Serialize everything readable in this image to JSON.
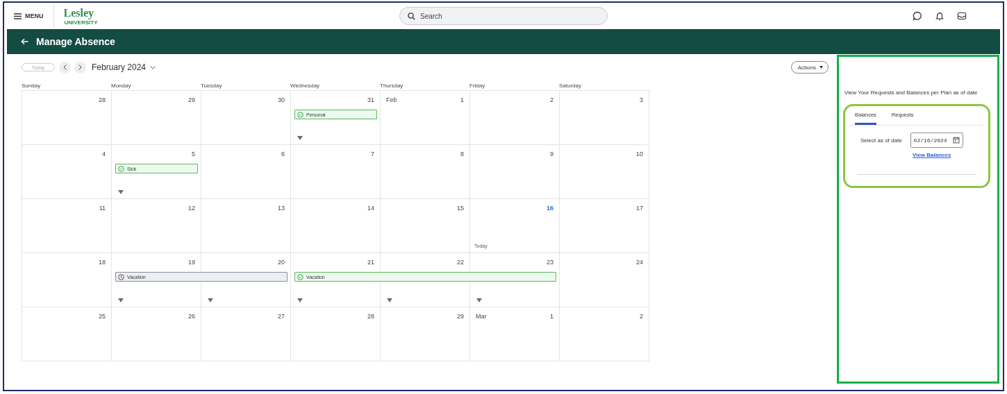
{
  "header": {
    "menu_label": "MENU",
    "logo": "Lesley",
    "logo_sub": "UNIVERSITY",
    "search_placeholder": "Search"
  },
  "page_title": "Manage Absence",
  "toolbar": {
    "today": {
      "label": "Today",
      "disabled": true
    },
    "month": "February 2024",
    "actions": "Actions"
  },
  "weekdays": [
    "Sunday",
    "Monday",
    "Tuesday",
    "Wednesday",
    "Thursday",
    "Friday",
    "Saturday"
  ],
  "weeks": [
    {
      "days": [
        {
          "number": "28"
        },
        {
          "number": "29"
        },
        {
          "number": "30"
        },
        {
          "number": "31",
          "more": true,
          "event": {
            "label": "Personal",
            "kind": "approved"
          }
        },
        {
          "month": "Feb",
          "number": "1"
        },
        {
          "number": "2"
        },
        {
          "number": "3"
        }
      ]
    },
    {
      "days": [
        {
          "number": "4"
        },
        {
          "number": "5",
          "more": true,
          "event": {
            "label": "Sick",
            "kind": "approved"
          }
        },
        {
          "number": "6"
        },
        {
          "number": "7"
        },
        {
          "number": "8"
        },
        {
          "number": "9"
        },
        {
          "number": "10"
        }
      ]
    },
    {
      "days": [
        {
          "number": "11"
        },
        {
          "number": "12"
        },
        {
          "number": "13"
        },
        {
          "number": "14"
        },
        {
          "number": "15"
        },
        {
          "number": "16",
          "today": true,
          "note": "Today"
        },
        {
          "number": "17"
        }
      ]
    },
    {
      "days": [
        {
          "number": "18"
        },
        {
          "number": "19",
          "more": true,
          "event": {
            "label": "Vacation",
            "kind": "submitted"
          }
        },
        {
          "number": "20",
          "more": true,
          "continues": true
        },
        {
          "number": "21",
          "more": true,
          "event": {
            "label": "Vacation",
            "kind": "approved"
          }
        },
        {
          "number": "22",
          "more": true,
          "continues": true
        },
        {
          "number": "23",
          "more": true,
          "continues": true
        },
        {
          "number": "24"
        }
      ]
    },
    {
      "days": [
        {
          "number": "25"
        },
        {
          "number": "26"
        },
        {
          "number": "27"
        },
        {
          "number": "28"
        },
        {
          "number": "29"
        },
        {
          "month": "Mar",
          "number": "1"
        },
        {
          "number": "2"
        }
      ]
    }
  ],
  "panel": {
    "heading": "View Your Requests and Balances per Plan as of date",
    "tabs": [
      {
        "label": "Balances",
        "selected": true
      },
      {
        "label": "Requests",
        "selected": false
      }
    ],
    "date_label": "Select as of date",
    "date_value": "02/16/2024",
    "link": "View Balances"
  }
}
